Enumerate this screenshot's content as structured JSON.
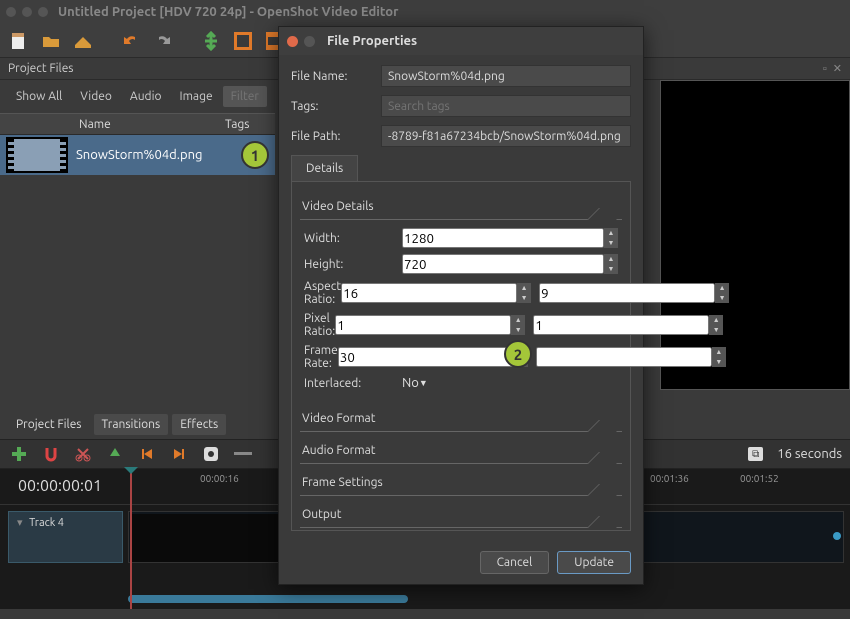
{
  "window": {
    "title": "Untitled Project [HDV 720 24p] - OpenShot Video Editor"
  },
  "panels": {
    "project_files": "Project Files"
  },
  "filters": {
    "show_all": "Show All",
    "video": "Video",
    "audio": "Audio",
    "image": "Image",
    "filter_placeholder": "Filter"
  },
  "file_list": {
    "col_name": "Name",
    "col_tags": "Tags",
    "row1_name": "SnowStorm%04d.png"
  },
  "callouts": {
    "one": "1",
    "two": "2"
  },
  "bottom_tabs": {
    "project_files": "Project Files",
    "transitions": "Transitions",
    "effects": "Effects"
  },
  "timeline": {
    "timecode": "00:00:00:01",
    "seconds_label": "16 seconds",
    "ticks": {
      "t1": "00:00:16",
      "t2": "00:01:36",
      "t3": "00:01:52"
    },
    "track": "Track 4"
  },
  "dialog": {
    "title": "File Properties",
    "file_name_label": "File Name:",
    "file_name": "SnowStorm%04d.png",
    "tags_label": "Tags:",
    "tags_placeholder": "Search tags",
    "file_path_label": "File Path:",
    "file_path": "-8789-f81a67234bcb/SnowStorm%04d.png",
    "tab_details": "Details",
    "sections": {
      "video_details": "Video Details",
      "video_format": "Video Format",
      "audio_format": "Audio Format",
      "frame_settings": "Frame Settings",
      "output": "Output"
    },
    "fields": {
      "width_label": "Width:",
      "width": "1280",
      "height_label": "Height:",
      "height": "720",
      "aspect_label": "Aspect Ratio:",
      "aspect_w": "16",
      "aspect_h": "9",
      "pixel_label": "Pixel Ratio:",
      "pixel_w": "1",
      "pixel_h": "1",
      "fps_label": "Frame Rate:",
      "fps_num": "30",
      "fps_den": "",
      "interlaced_label": "Interlaced:",
      "interlaced": "No"
    },
    "buttons": {
      "cancel": "Cancel",
      "update": "Update"
    }
  }
}
